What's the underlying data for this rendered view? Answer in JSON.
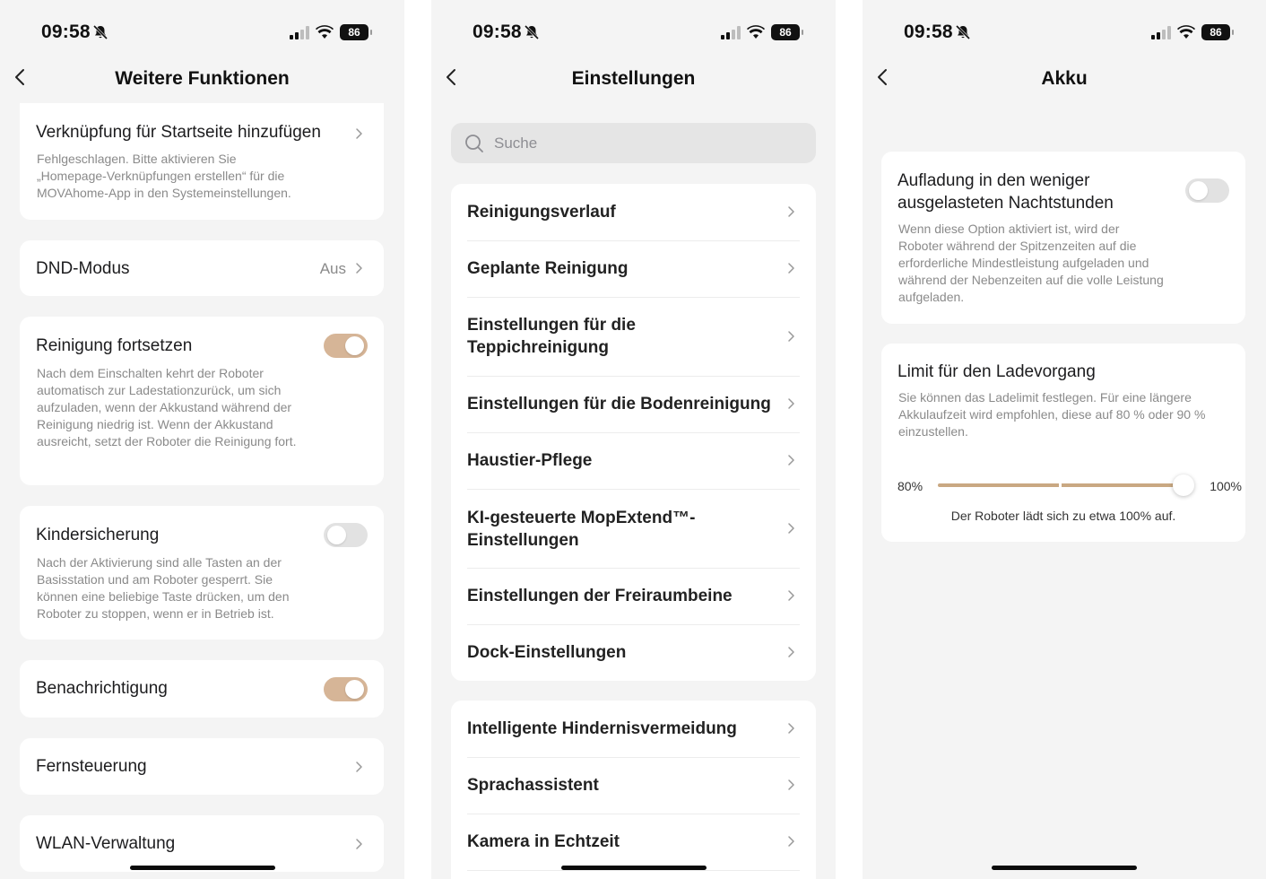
{
  "status_bar": {
    "time": "09:58",
    "battery": "86"
  },
  "screen1": {
    "title": "Weitere Funktionen",
    "shortcut": {
      "title": "Verknüpfung für Startseite hinzufügen",
      "desc": "Fehlgeschlagen. Bitte aktivieren Sie „Homepage-Verknüpfungen erstellen“ für die MOVAhome-App in den Systemeinstellungen."
    },
    "dnd": {
      "title": "DND-Modus",
      "value": "Aus"
    },
    "resume": {
      "title": "Reinigung fortsetzen",
      "desc": "Nach dem Einschalten kehrt der Roboter automatisch zur Ladestationzurück, um sich aufzuladen, wenn der Akkustand während der Reinigung niedrig ist. Wenn der Akkustand ausreicht, setzt der Roboter die Reinigung fort.",
      "enabled": true
    },
    "child_lock": {
      "title": "Kindersicherung",
      "desc": "Nach der Aktivierung sind alle Tasten an der Basisstation und am Roboter gesperrt. Sie können eine beliebige Taste drücken, um den Roboter zu stoppen, wenn er in Betrieb ist.",
      "enabled": false
    },
    "notification": {
      "title": "Benachrichtigung",
      "enabled": true
    },
    "remote": {
      "title": "Fernsteuerung"
    },
    "wlan": {
      "title": "WLAN-Verwaltung"
    }
  },
  "screen2": {
    "title": "Einstellungen",
    "search_placeholder": "Suche",
    "group1": [
      "Reinigungsverlauf",
      "Geplante Reinigung",
      "Einstellungen für die Teppichreinigung",
      "Einstellungen für die Bodenreinigung",
      "Haustier-Pflege",
      "KI-gesteuerte MopExtend™-Einstellungen",
      "Einstellungen der Freiraumbeine",
      "Dock-Einstellungen"
    ],
    "group2": [
      "Intelligente Hindernisvermeidung",
      "Sprachassistent",
      "Kamera in Echtzeit"
    ]
  },
  "screen3": {
    "title": "Akku",
    "offpeak": {
      "title": "Aufladung in den weniger ausgelasteten Nachtstunden",
      "desc": "Wenn diese Option aktiviert ist, wird der Roboter während der Spitzenzeiten auf die erforderliche Mindestleistung aufgeladen und während der Nebenzeiten auf die volle Leistung aufgeladen.",
      "enabled": false
    },
    "limit": {
      "title": "Limit für den Ladevorgang",
      "desc": "Sie können das Ladelimit festlegen. Für eine längere Akkulaufzeit wird empfohlen, diese auf 80 % oder 90 % einzustellen.",
      "min_label": "80%",
      "max_label": "100%",
      "value_percent": 100,
      "note": "Der Roboter lädt sich zu etwa 100% auf."
    }
  },
  "colors": {
    "accent": "#d6b597",
    "background": "#f4f4f4",
    "card": "#ffffff",
    "secondary_text": "#8a8a8a"
  },
  "icons": [
    "bell-slash-icon",
    "signal-icon",
    "wifi-icon",
    "battery-icon",
    "back-chevron-icon",
    "chevron-right-icon",
    "search-icon"
  ]
}
